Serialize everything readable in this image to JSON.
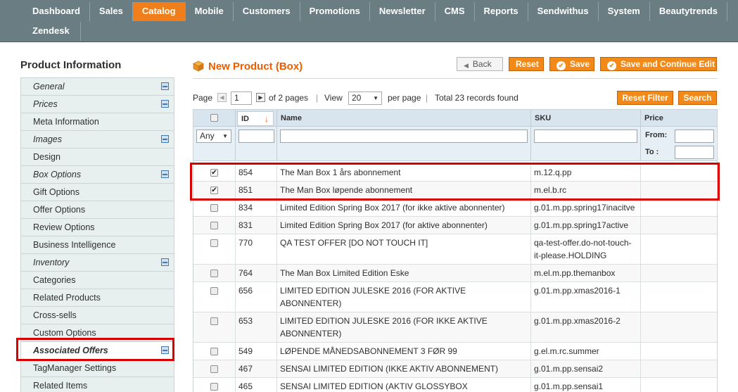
{
  "nav": {
    "items": [
      "Dashboard",
      "Sales",
      "Catalog",
      "Mobile",
      "Customers",
      "Promotions",
      "Newsletter",
      "CMS",
      "Reports",
      "Sendwithus",
      "System",
      "Beautytrends"
    ],
    "row2": [
      "Zendesk"
    ],
    "active": "Catalog"
  },
  "sidebar": {
    "title": "Product Information",
    "items": [
      {
        "label": "General",
        "italic": true,
        "icon": true
      },
      {
        "label": "Prices",
        "italic": true,
        "icon": true
      },
      {
        "label": "Meta Information",
        "italic": false,
        "icon": false
      },
      {
        "label": "Images",
        "italic": true,
        "icon": true
      },
      {
        "label": "Design",
        "italic": false,
        "icon": false
      },
      {
        "label": "Box Options",
        "italic": true,
        "icon": true
      },
      {
        "label": "Gift Options",
        "italic": false,
        "icon": false
      },
      {
        "label": "Offer Options",
        "italic": false,
        "icon": false
      },
      {
        "label": "Review Options",
        "italic": false,
        "icon": false
      },
      {
        "label": "Business Intelligence",
        "italic": false,
        "icon": false
      },
      {
        "label": "Inventory",
        "italic": true,
        "icon": true
      },
      {
        "label": "Categories",
        "italic": false,
        "icon": false
      },
      {
        "label": "Related Products",
        "italic": false,
        "icon": false
      },
      {
        "label": "Cross-sells",
        "italic": false,
        "icon": false
      },
      {
        "label": "Custom Options",
        "italic": false,
        "icon": false
      },
      {
        "label": "Associated Offers",
        "italic": true,
        "icon": true,
        "active": true
      },
      {
        "label": "TagManager Settings",
        "italic": false,
        "icon": false
      },
      {
        "label": "Related Items",
        "italic": false,
        "icon": false
      }
    ]
  },
  "header": {
    "title": "New Product (Box)",
    "back_label": "Back",
    "reset_label": "Reset",
    "save_label": "Save",
    "save_continue_label": "Save and Continue Edit"
  },
  "pager": {
    "page_label": "Page",
    "page_value": "1",
    "of_pages": "of 2 pages",
    "view_label": "View",
    "view_value": "20",
    "per_page": "per page",
    "total": "Total 23 records found",
    "reset_filter_label": "Reset Filter",
    "search_label": "Search"
  },
  "grid": {
    "columns": {
      "id": "ID",
      "name": "Name",
      "sku": "SKU",
      "price": "Price"
    },
    "filter_any": "Any",
    "price_from": "From:",
    "price_to": "To :",
    "rows": [
      {
        "checked": true,
        "id": "854",
        "name": "The Man Box 1 års abonnement",
        "sku": "m.12.q.pp"
      },
      {
        "checked": true,
        "id": "851",
        "name": "The Man Box løpende abonnement",
        "sku": "m.el.b.rc"
      },
      {
        "checked": false,
        "id": "834",
        "name": "Limited Edition Spring Box 2017 (for ikke aktive abonnenter)",
        "sku": "g.01.m.pp.spring17inacitve"
      },
      {
        "checked": false,
        "id": "831",
        "name": "Limited Edition Spring Box 2017 (for aktive abonnenter)",
        "sku": "g.01.m.pp.spring17active"
      },
      {
        "checked": false,
        "id": "770",
        "name": "QA TEST OFFER [DO NOT TOUCH IT]",
        "sku": "qa-test-offer.do-not-touch-it-please.HOLDING"
      },
      {
        "checked": false,
        "id": "764",
        "name": "The Man Box Limited Edition Eske",
        "sku": "m.el.m.pp.themanbox"
      },
      {
        "checked": false,
        "id": "656",
        "name": "LIMITED EDITION JULESKE 2016 (FOR AKTIVE ABONNENTER)",
        "sku": "g.01.m.pp.xmas2016-1"
      },
      {
        "checked": false,
        "id": "653",
        "name": "LIMITED EDITION JULESKE 2016 (FOR IKKE AKTIVE ABONNENTER)",
        "sku": "g.01.m.pp.xmas2016-2"
      },
      {
        "checked": false,
        "id": "549",
        "name": "LØPENDE MÅNEDSABONNEMENT 3 FØR 99",
        "sku": "g.el.m.rc.summer"
      },
      {
        "checked": false,
        "id": "467",
        "name": "SENSAI LIMITED EDITION (IKKE AKTIV ABONNEMENT)",
        "sku": "g.01.m.pp.sensai2"
      },
      {
        "checked": false,
        "id": "465",
        "name": "SENSAI LIMITED EDITION (AKTIV GLOSSYBOX ABONNEMENT)",
        "sku": "g.01.m.pp.sensai1"
      }
    ]
  }
}
